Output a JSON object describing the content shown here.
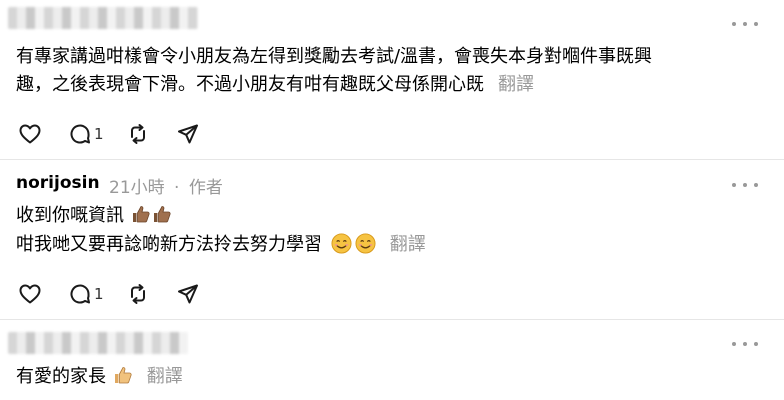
{
  "posts": [
    {
      "username": "",
      "time": "",
      "author_tag": "",
      "lines": [
        "有專家講過咁樣會令小朋友為左得到獎勵去考試/溫書，會喪失本身對嗰件事既興",
        "趣，之後表現會下滑。不過小朋友有咁有趣既父母係開心既"
      ],
      "translate_label": "翻譯",
      "reply_count": "1"
    },
    {
      "username": "norijosin",
      "time": "21小時",
      "separator": "·",
      "author_tag": "作者",
      "lines": [
        "收到你嘅資訊",
        "咁我哋又要再諗啲新方法拎去努力學習"
      ],
      "translate_label": "翻譯",
      "reply_count": "1"
    },
    {
      "username": "",
      "lines": [
        "有愛的家長"
      ],
      "translate_label": "翻譯"
    }
  ],
  "icons": {
    "like": "heart-icon",
    "reply": "speech-bubble-icon",
    "repost": "repost-arrows-icon",
    "share": "send-arrow-icon",
    "more": "more-dots-icon"
  },
  "colors": {
    "text": "#000000",
    "muted": "#999999",
    "icon": "#1a1a1a",
    "divider": "#e6e6e6",
    "thumb_brown": "#a0704e",
    "thumb_light": "#f1c27d",
    "smile": "#f6c342"
  }
}
